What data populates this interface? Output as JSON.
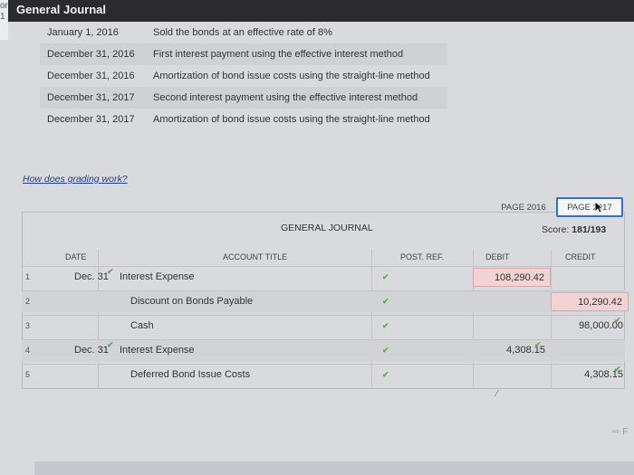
{
  "window": {
    "title": "General Journal",
    "edge_tab_lines": [
      "or",
      "1"
    ]
  },
  "events": [
    {
      "date": "January 1, 2016",
      "desc": "Sold the bonds at an effective rate of 8%"
    },
    {
      "date": "December 31, 2016",
      "desc": "First interest payment using the effective interest method"
    },
    {
      "date": "December 31, 2016",
      "desc": "Amortization of bond issue costs using the straight-line method"
    },
    {
      "date": "December 31, 2017",
      "desc": "Second interest payment using the effective interest method"
    },
    {
      "date": "December 31, 2017",
      "desc": "Amortization of bond issue costs using the straight-line method"
    }
  ],
  "grading_link": "How does grading work?",
  "pages": {
    "page1": "PAGE 2016",
    "page2": "PAGE 2017"
  },
  "score": {
    "label": "Score:",
    "value": "181/193"
  },
  "journal": {
    "title": "GENERAL JOURNAL",
    "headers": {
      "date": "DATE",
      "account": "ACCOUNT TITLE",
      "post_ref": "POST. REF.",
      "debit": "DEBIT",
      "credit": "CREDIT"
    },
    "rows": [
      {
        "num": "1",
        "date": "Dec. 31",
        "account": "Interest Expense",
        "debit": "108,290.42",
        "credit": ""
      },
      {
        "num": "2",
        "date": "",
        "account": "Discount on Bonds Payable",
        "debit": "",
        "credit": "10,290.42"
      },
      {
        "num": "3",
        "date": "",
        "account": "Cash",
        "debit": "",
        "credit": "98,000.00"
      },
      {
        "num": "4",
        "date": "Dec. 31",
        "account": "Interest Expense",
        "debit": "4,308.15",
        "credit": ""
      },
      {
        "num": "5",
        "date": "",
        "account": "Deferred Bond Issue Costs",
        "debit": "",
        "credit": "4,308.15"
      }
    ]
  },
  "edge_letter": "F",
  "colors": {
    "check": "#58b04a",
    "error_fill": "#f2d3d3",
    "link": "#1f3e8f",
    "active_page_border": "#2f6fcf"
  }
}
